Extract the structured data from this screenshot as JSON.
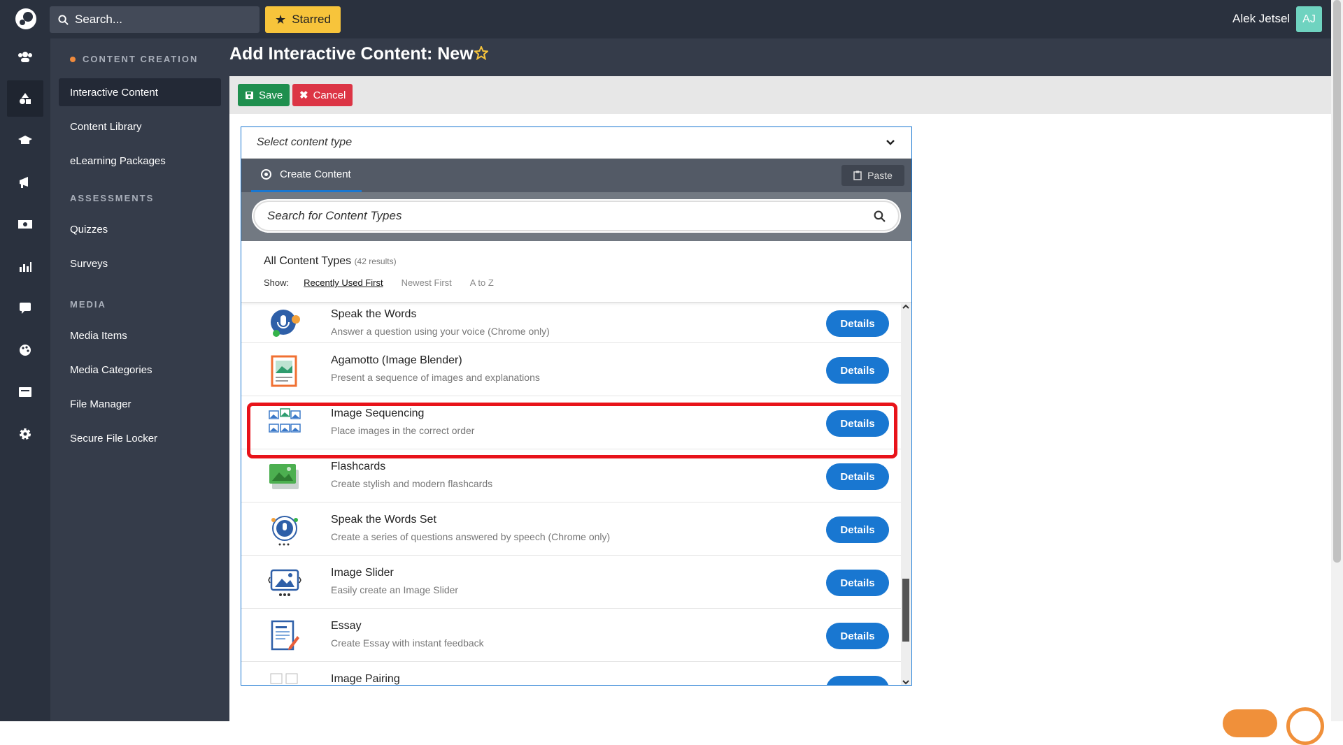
{
  "topbar": {
    "search_placeholder": "Search...",
    "starred_label": "Starred",
    "user_name": "Alek Jetsel",
    "avatar_initials": "AJ"
  },
  "rail": [
    "users-icon",
    "shapes-icon",
    "graduation-cap-icon",
    "megaphone-icon",
    "money-icon",
    "chart-icon",
    "comment-icon",
    "palette-icon",
    "id-card-icon",
    "gear-icon"
  ],
  "sidebar": {
    "content_creation": "CONTENT CREATION",
    "items_creation": [
      "Interactive Content",
      "Content Library",
      "eLearning Packages"
    ],
    "assessments": "ASSESSMENTS",
    "items_assessments": [
      "Quizzes",
      "Surveys"
    ],
    "media": "MEDIA",
    "items_media": [
      "Media Items",
      "Media Categories",
      "File Manager",
      "Secure File Locker"
    ]
  },
  "page": {
    "title": "Add Interactive Content: New",
    "save_label": "Save",
    "cancel_label": "Cancel"
  },
  "editor": {
    "select_label": "Select content type",
    "tab_label": "Create Content",
    "paste_label": "Paste",
    "search_placeholder": "Search for Content Types",
    "list_title": "All Content Types",
    "result_count": "(42 results)",
    "show_label": "Show:",
    "sort_options": [
      "Recently Used First",
      "Newest First",
      "A to Z"
    ],
    "details_label": "Details",
    "rows": [
      {
        "title": "Speak the Words",
        "desc": "Answer a question using your voice (Chrome only)",
        "icon": "microphone-icon"
      },
      {
        "title": "Agamotto (Image Blender)",
        "desc": "Present a sequence of images and explanations",
        "icon": "image-blender-icon"
      },
      {
        "title": "Image Sequencing",
        "desc": "Place images in the correct order",
        "icon": "image-sequence-icon"
      },
      {
        "title": "Flashcards",
        "desc": "Create stylish and modern flashcards",
        "icon": "flashcards-icon"
      },
      {
        "title": "Speak the Words Set",
        "desc": "Create a series of questions answered by speech (Chrome only)",
        "icon": "microphone-set-icon"
      },
      {
        "title": "Image Slider",
        "desc": "Easily create an Image Slider",
        "icon": "image-slider-icon"
      },
      {
        "title": "Essay",
        "desc": "Create Essay with instant feedback",
        "icon": "essay-icon"
      },
      {
        "title": "Image Pairing",
        "desc": "",
        "icon": "image-pairing-icon"
      }
    ]
  },
  "colors": {
    "accent": "#1977d1",
    "starred": "#f7c43b",
    "highlight": "#e8131a"
  }
}
